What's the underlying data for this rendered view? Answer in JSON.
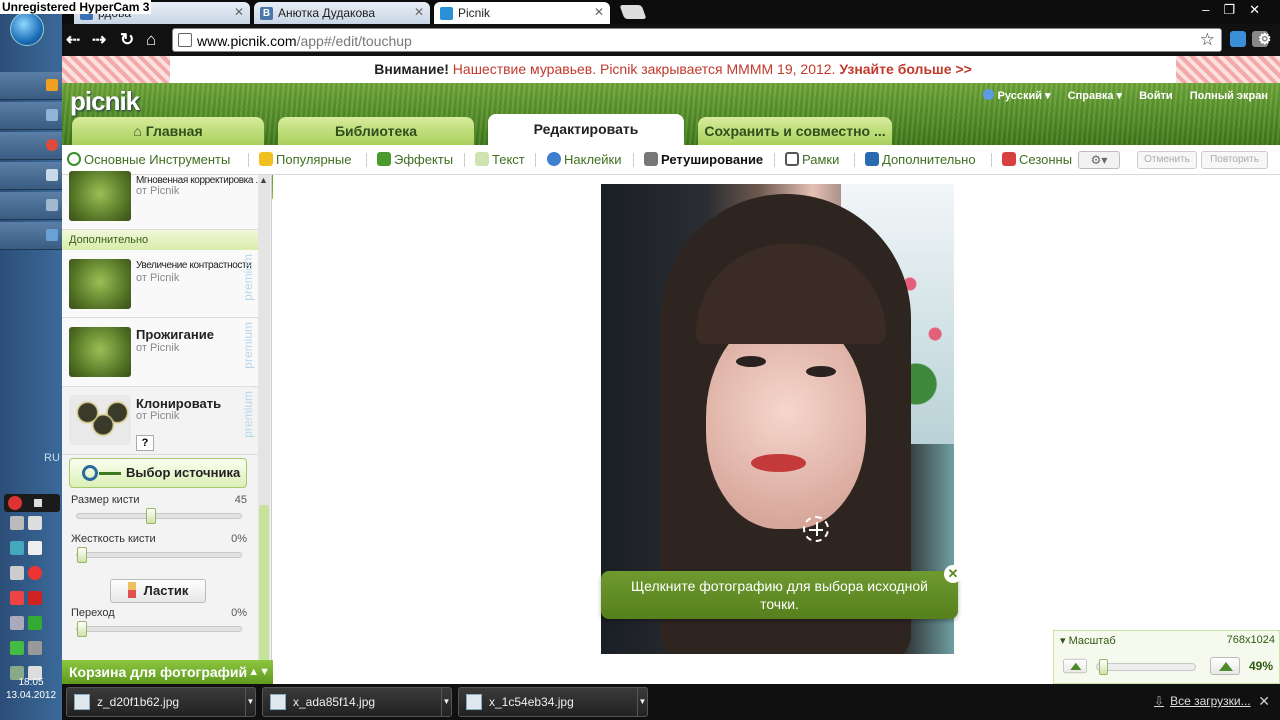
{
  "recorder": {
    "watermark": "Unregistered HyperCam 3"
  },
  "os": {
    "language": "RU",
    "clock_time": "18:05",
    "clock_date": "13.04.2012"
  },
  "browser": {
    "tabs": [
      {
        "label": "рдова",
        "icon_color": "#3b6fb6"
      },
      {
        "label": "Анютка Дудакова",
        "icon_color": "#4a76a8",
        "icon_text": "B"
      },
      {
        "label": "Picnik",
        "icon_color": "#2a8fd6"
      }
    ],
    "url_host": "www.picnik.com",
    "url_path": "/app#/edit/touchup"
  },
  "banner": {
    "warning": "Внимание!",
    "message": "Нашествие муравьев. Picnik закрывается ММММ 19, 2012.",
    "link": "Узнайте больше >>"
  },
  "header": {
    "logo": "picnik",
    "language": "Русский",
    "help": "Справка",
    "login": "Войти",
    "fullscreen": "Полный экран"
  },
  "nav_tabs": [
    {
      "label": "Главная",
      "icon": "house-icon"
    },
    {
      "label": "Библиотека"
    },
    {
      "label": "Редактировать",
      "active": true
    },
    {
      "label": "Сохранить и совместно ..."
    }
  ],
  "tool_tabs": [
    {
      "label": "Основные Инструменты",
      "icon": "basic-tools-icon",
      "color": "#3a8f2a"
    },
    {
      "label": "Популярные",
      "icon": "star-icon",
      "color": "#f0c020"
    },
    {
      "label": "Эффекты",
      "icon": "effects-icon",
      "color": "#4b9a2c"
    },
    {
      "label": "Текст",
      "icon": "text-icon",
      "color": "#3a7a2a"
    },
    {
      "label": "Наклейки",
      "icon": "stickers-icon",
      "color": "#3f7fd0"
    },
    {
      "label": "Ретуширование",
      "icon": "retouch-icon",
      "color": "#777777",
      "active": true
    },
    {
      "label": "Рамки",
      "icon": "frames-icon",
      "color": "#555555"
    },
    {
      "label": "Дополнительно",
      "icon": "more-icon",
      "color": "#2a6ab0"
    },
    {
      "label": "Сезонны",
      "icon": "calendar-icon",
      "color": "#d84040"
    }
  ],
  "edit_actions": {
    "undo": "Отменить",
    "redo": "Повторить"
  },
  "effects_panel": {
    "items": [
      {
        "name": "Мгновенная корректировка ...",
        "by": "от Picnik",
        "premium": ""
      },
      {
        "name": "Увеличение контрастности",
        "by": "от Picnik",
        "premium": "premium"
      },
      {
        "name": "Прожигание",
        "by": "от Picnik",
        "premium": "premium"
      },
      {
        "name": "Клонировать",
        "by": "от Picnik",
        "premium": "premium",
        "help": "?"
      }
    ],
    "section_title": "Дополнительно",
    "source_button": "Выбор источника",
    "brush_size_label": "Размер кисти",
    "brush_size_value": "45",
    "brush_size_fraction": 0.45,
    "hardness_label": "Жесткость кисти",
    "hardness_value": "0%",
    "hardness_fraction": 0,
    "eraser_button": "Ластик",
    "fade_label": "Переход",
    "fade_value": "0%",
    "fade_fraction": 0
  },
  "photo_basket": "Корзина для фотографий",
  "canvas": {
    "tooltip_line1": "Щелкните фотографию для выбора исходной",
    "tooltip_line2": "точки."
  },
  "zoom": {
    "label": "Масштаб",
    "dimensions": "768x1024",
    "percent": "49%",
    "fraction": 0.02
  },
  "downloads": {
    "files": [
      "z_d20f1b62.jpg",
      "x_ada85f14.jpg",
      "x_1c54eb34.jpg"
    ],
    "all_downloads": "Все загрузки..."
  }
}
